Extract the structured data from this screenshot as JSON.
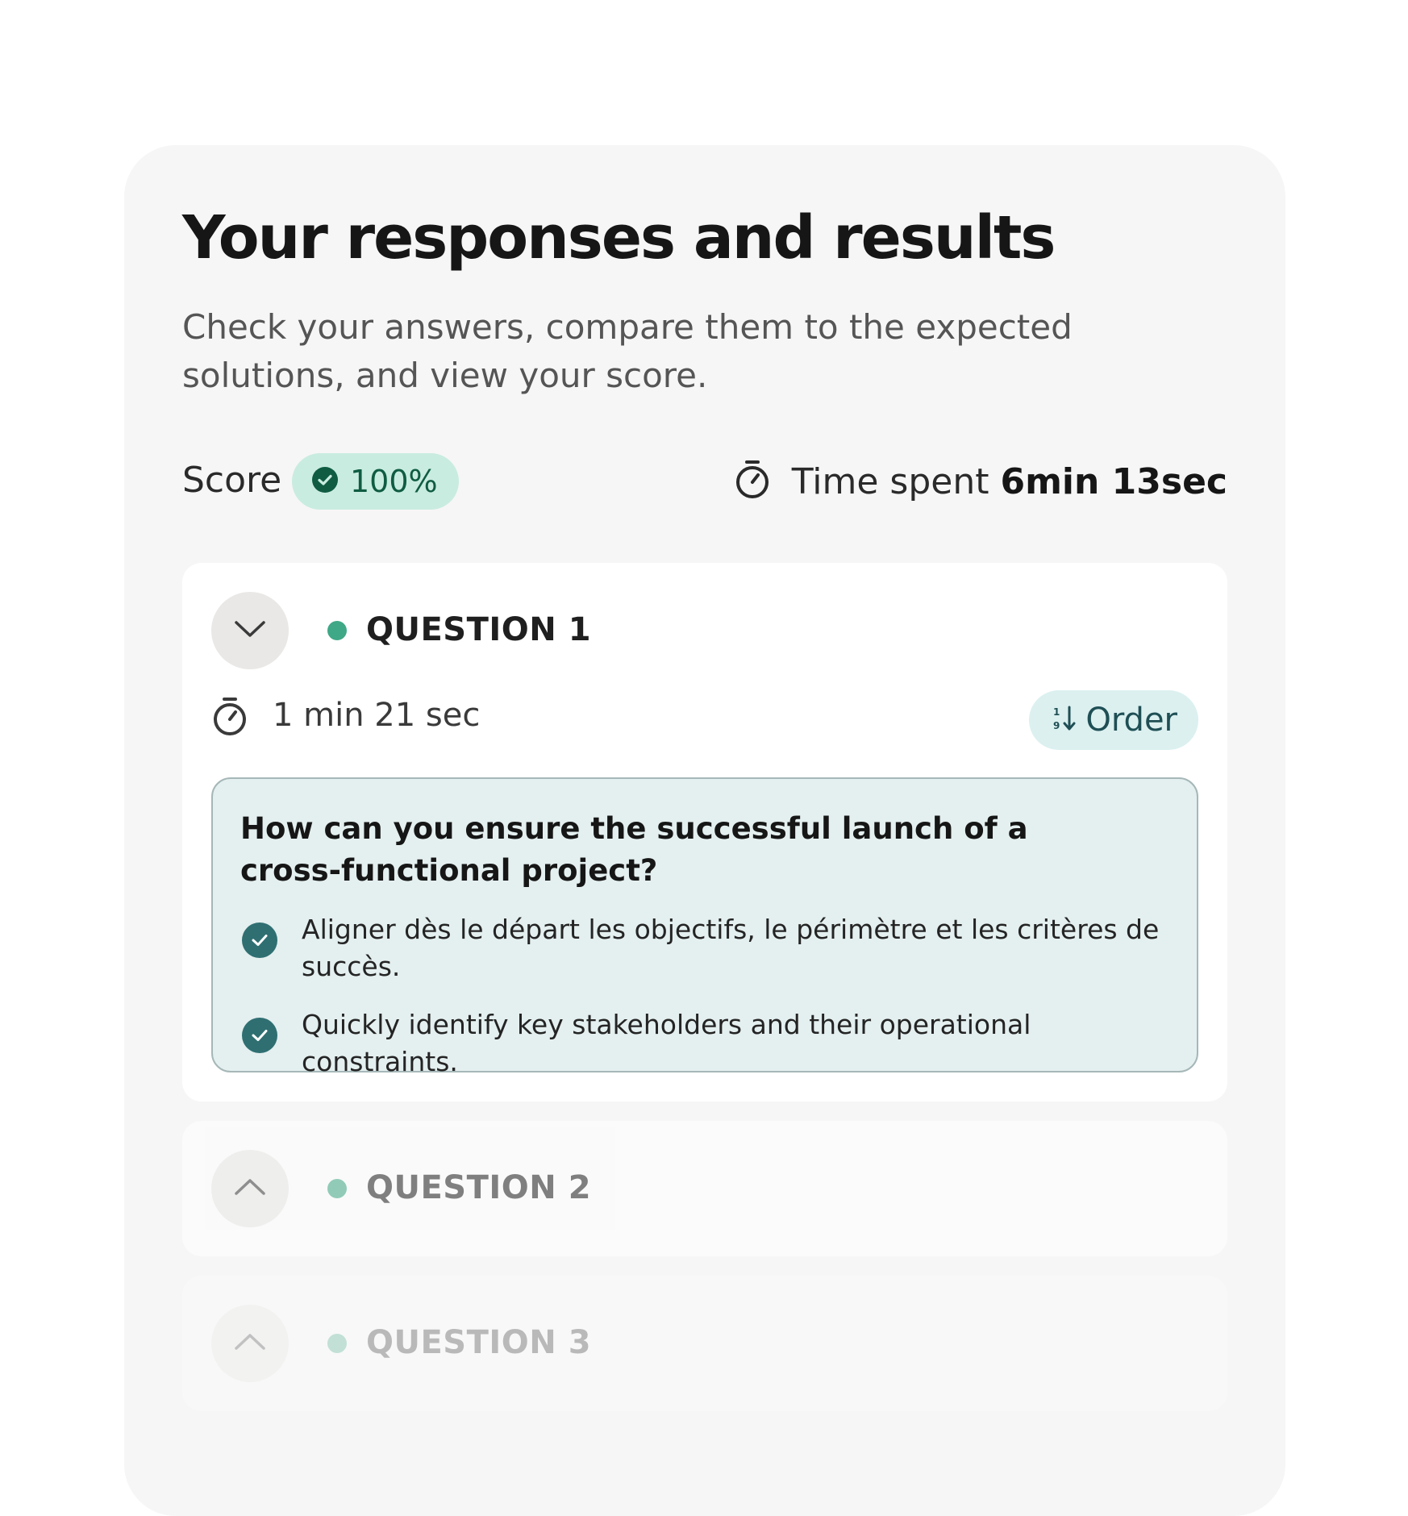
{
  "header": {
    "title": "Your responses and results",
    "subtitle": "Check your answers, compare them to the expected solutions, and view your score."
  },
  "stats": {
    "score_label": "Score",
    "score_value": "100%",
    "time_label": "Time spent",
    "time_value": "6min 13sec"
  },
  "questions": [
    {
      "title": "QUESTION 1",
      "expanded": true,
      "time": "1 min 21 sec",
      "order_label": "Order",
      "prompt": "How can you ensure the successful launch of a cross-functional project?",
      "answers": [
        "Aligner dès le départ les objectifs, le périmètre et les critères de succès.",
        "Quickly identify key stakeholders and their operational constraints."
      ]
    },
    {
      "title": "QUESTION 2",
      "expanded": false
    },
    {
      "title": "QUESTION 3",
      "expanded": false
    }
  ],
  "icons": {
    "score_badge": "check-circle-icon",
    "time": "stopwatch-icon",
    "order": "sort-order-icon",
    "answer": "check-circle-icon",
    "toggle_expanded": "chevron-down-icon",
    "toggle_collapsed": "chevron-up-icon"
  },
  "colors": {
    "accent_green": "#3fa886",
    "score_badge_bg": "#c9ece0",
    "order_badge_bg": "#dcf0f0",
    "answer_box_bg": "#e4efef",
    "check_fill": "#2f6f72"
  }
}
